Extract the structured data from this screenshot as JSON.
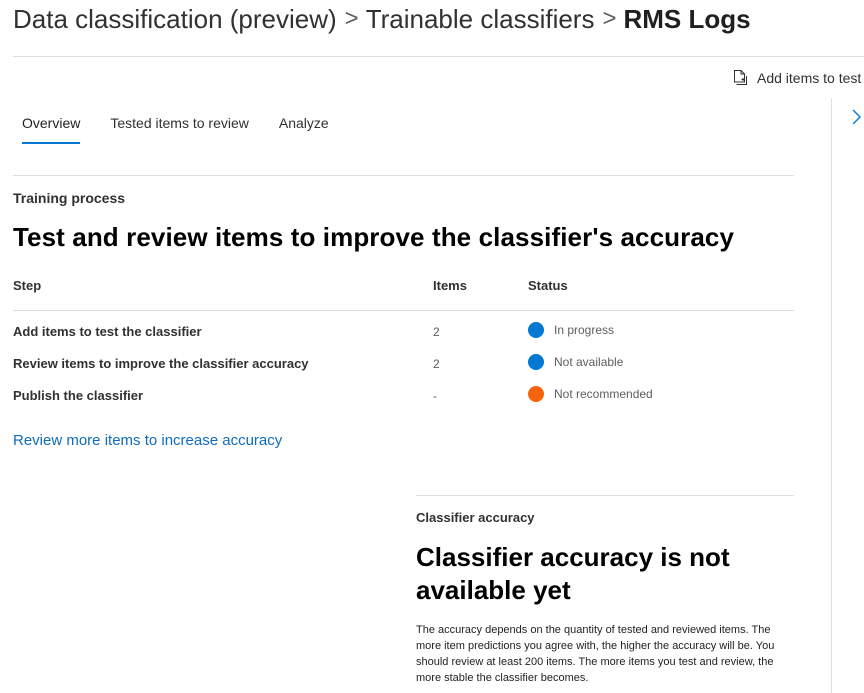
{
  "breadcrumb": {
    "items": [
      "Data classification (preview)",
      "Trainable classifiers"
    ],
    "current": "RMS Logs",
    "separator": ">"
  },
  "command_bar": {
    "add_items_label": "Add items to test",
    "add_items_icon": "document-add-icon"
  },
  "panel": {
    "toggle_icon": "chevron-right-icon"
  },
  "tabs": [
    {
      "label": "Overview",
      "active": true
    },
    {
      "label": "Tested items to review",
      "active": false
    },
    {
      "label": "Analyze",
      "active": false
    }
  ],
  "training": {
    "section_label": "Training process",
    "heading": "Test and review items to improve the classifier's accuracy",
    "columns": {
      "step": "Step",
      "items": "Items",
      "status": "Status"
    },
    "rows": [
      {
        "step": "Add items to test the classifier",
        "items": "2",
        "status": "In progress",
        "status_color": "#0078d4"
      },
      {
        "step": "Review items to improve the classifier accuracy",
        "items": "2",
        "status": "Not available",
        "status_color": "#0078d4"
      },
      {
        "step": "Publish the classifier",
        "items": "-",
        "status": "Not recommended",
        "status_color": "#f7630c"
      }
    ],
    "link": "Review more items to increase accuracy"
  },
  "accuracy": {
    "label": "Classifier accuracy",
    "heading": "Classifier accuracy is not available yet",
    "description": "The accuracy depends on the quantity of tested and reviewed items. The more item predictions you agree with, the higher the accuracy will be. You should review at least 200 items. The more items you test and review, the more stable the classifier becomes."
  },
  "colors": {
    "accent": "#0078d4",
    "link": "#0f6cbd",
    "warning": "#f7630c"
  }
}
